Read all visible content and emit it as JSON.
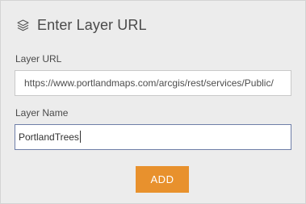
{
  "dialog": {
    "title": "Enter Layer URL",
    "icon": "layers-icon"
  },
  "url_field": {
    "label": "Layer URL",
    "value": "https://www.portlandmaps.com/arcgis/rest/services/Public/"
  },
  "name_field": {
    "label": "Layer Name",
    "value": "PortlandTrees"
  },
  "actions": {
    "add_label": "ADD"
  },
  "colors": {
    "panel_bg": "#ececec",
    "accent": "#e8912d",
    "focus_border": "#6e7fa8"
  }
}
